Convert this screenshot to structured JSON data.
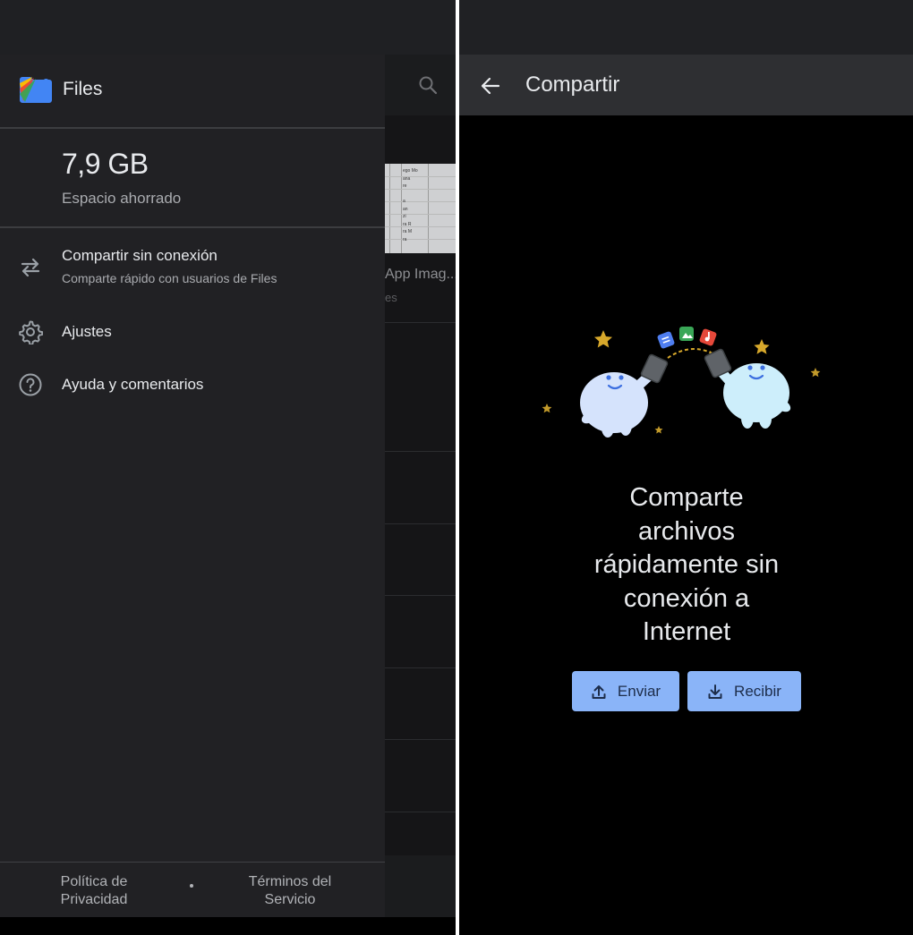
{
  "left_screen": {
    "background_app": {
      "thumbnail_text": "ego Mo\nana\nre\n\na\nan\nzi\nra R\nra M\nra",
      "file_caption": "App Imag...",
      "file_sub": "es"
    },
    "drawer": {
      "app_title": "Files",
      "storage": {
        "size": "7,9 GB",
        "label": "Espacio ahorrado"
      },
      "menu": [
        {
          "icon": "swap-arrows-icon",
          "title": "Compartir sin conexión",
          "subtitle": "Comparte rápido con usuarios de Files"
        },
        {
          "icon": "gear-icon",
          "title": "Ajustes"
        },
        {
          "icon": "help-circle-icon",
          "title": "Ayuda y comentarios"
        }
      ],
      "footer": {
        "privacy_line1": "Política de",
        "privacy_line2": "Privacidad",
        "terms_line1": "Términos del",
        "terms_line2": "Servicio"
      }
    }
  },
  "right_screen": {
    "appbar": {
      "title": "Compartir",
      "back_icon": "arrow-left-icon"
    },
    "illustration": "two-characters-sharing-files",
    "headline_lines": [
      "Comparte",
      "archivos",
      "rápidamente sin",
      "conexión a",
      "Internet"
    ],
    "send_button": {
      "label": "Enviar",
      "icon": "upload-icon"
    },
    "receive_button": {
      "label": "Recibir",
      "icon": "download-icon"
    }
  },
  "colors": {
    "drawer_bg": "#212124",
    "appbar_bg": "#2e2f32",
    "button_bg": "#8ab4f8",
    "text_primary": "#e8eaed",
    "text_secondary": "#a9abaf"
  }
}
